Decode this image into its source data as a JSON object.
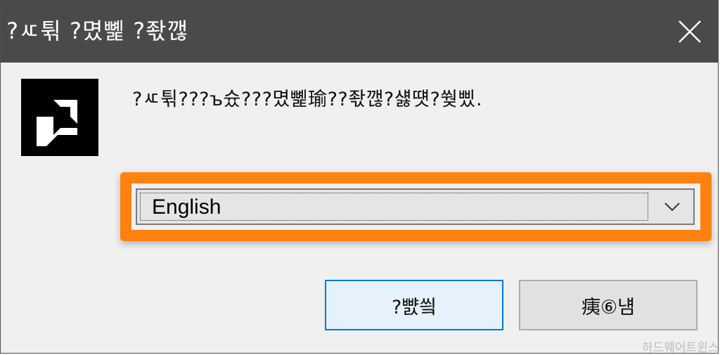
{
  "window": {
    "title": "?ㅼ튂 ?몄뼱 ?좏깮"
  },
  "logo": {
    "icon": "amd-logo-icon"
  },
  "message": "?ㅼ튂???ъ슜???몄뼱瑜??좏깮?섏떗?쒖삤.",
  "language_select": {
    "value": "English"
  },
  "buttons": {
    "ok_label": "?뺤씤",
    "cancel_label": "痍⑥냼"
  },
  "watermark": "하드웨어트윈스",
  "colors": {
    "titlebar": "#4a4a4a",
    "highlight": "#ff8210",
    "primary_border": "#0078d7"
  }
}
